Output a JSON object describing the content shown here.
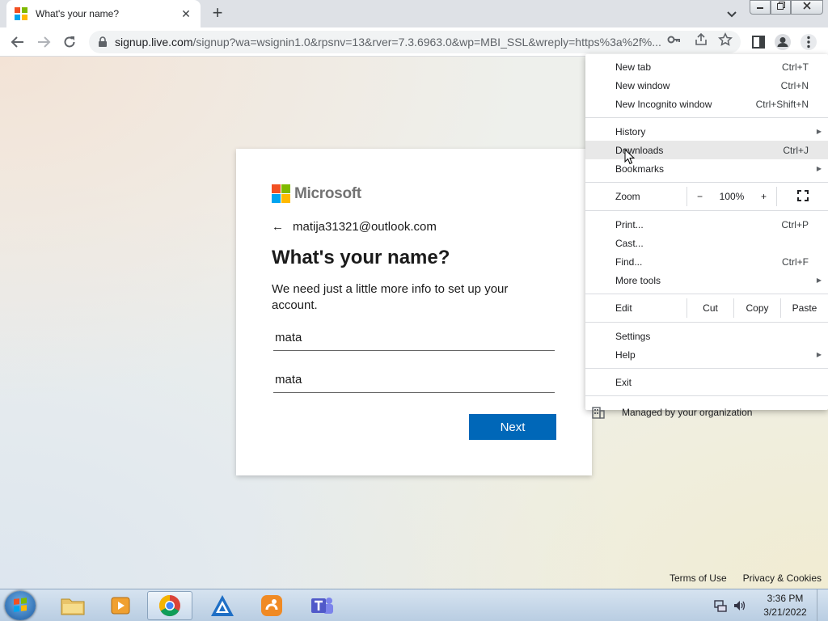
{
  "tab": {
    "title": "What's your name?",
    "close_glyph": "✕"
  },
  "newtab_glyph": "+",
  "address": {
    "host": "signup.live.com",
    "path": "/signup?wa=wsignin1.0&rpsnv=13&rver=7.3.6963.0&wp=MBI_SSL&wreply=https%3a%2f%..."
  },
  "card": {
    "brand": "Microsoft",
    "back_arrow": "←",
    "identity": "matija31321@outlook.com",
    "heading": "What's your name?",
    "description": "We need just a little more info to set up your account.",
    "first_name": "mata",
    "last_name": "mata",
    "next_label": "Next"
  },
  "footer": {
    "terms": "Terms of Use",
    "privacy": "Privacy & Cookies"
  },
  "menu": {
    "group1": [
      {
        "label": "New tab",
        "shortcut": "Ctrl+T"
      },
      {
        "label": "New window",
        "shortcut": "Ctrl+N"
      },
      {
        "label": "New Incognito window",
        "shortcut": "Ctrl+Shift+N"
      }
    ],
    "group2": [
      {
        "label": "History",
        "shortcut": ""
      },
      {
        "label": "Downloads",
        "shortcut": "Ctrl+J"
      },
      {
        "label": "Bookmarks",
        "shortcut": ""
      }
    ],
    "zoom": {
      "label": "Zoom",
      "minus": "−",
      "value": "100%",
      "plus": "+"
    },
    "group3": [
      {
        "label": "Print...",
        "shortcut": "Ctrl+P"
      },
      {
        "label": "Cast...",
        "shortcut": ""
      },
      {
        "label": "Find...",
        "shortcut": "Ctrl+F"
      },
      {
        "label": "More tools",
        "shortcut": ""
      }
    ],
    "edit": {
      "label": "Edit",
      "cut": "Cut",
      "copy": "Copy",
      "paste": "Paste"
    },
    "group4": [
      {
        "label": "Settings",
        "shortcut": ""
      },
      {
        "label": "Help",
        "shortcut": ""
      }
    ],
    "exit": "Exit",
    "managed": "Managed by your organization",
    "submenu_arrow": "▶"
  },
  "taskbar": {
    "time": "3:36 PM",
    "date": "3/21/2022"
  },
  "colors": {
    "accent": "#0067b8",
    "menu_highlight": "#e8e8e8"
  }
}
